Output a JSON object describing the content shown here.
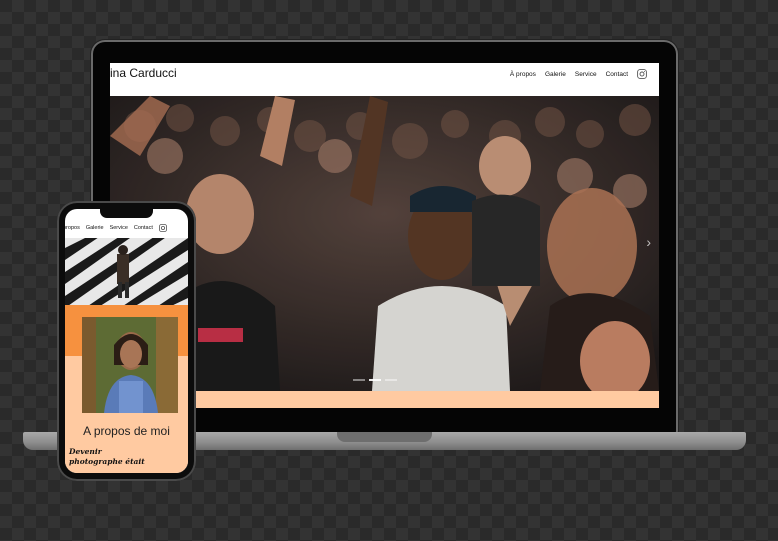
{
  "site": {
    "title": "ina Carducci",
    "nav": [
      "À propos",
      "Galerie",
      "Service",
      "Contact"
    ],
    "instagram_icon": "instagram-icon"
  },
  "slider": {
    "slide_count": 3,
    "active_index": 1
  },
  "mobile": {
    "nav": [
      "propos",
      "Galerie",
      "Service",
      "Contact"
    ],
    "heading": "A propos de moi",
    "subheading_line1": "Devenir",
    "subheading_line2": "photographe était"
  },
  "colors": {
    "orange": "#f6913f",
    "peach": "#ffcaa1",
    "laptop_frame": "#050505",
    "background": "#2a2a2a"
  }
}
